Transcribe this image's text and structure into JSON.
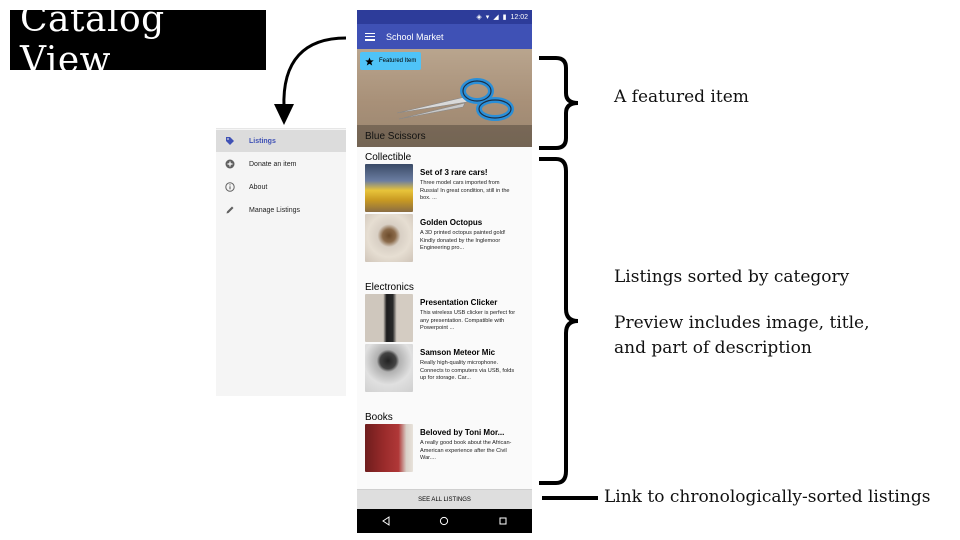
{
  "page_title": "Catalog View",
  "drawer": {
    "items": [
      {
        "label": "Listings",
        "icon": "tag-icon"
      },
      {
        "label": "Donate an item",
        "icon": "add-circle-icon"
      },
      {
        "label": "About",
        "icon": "info-icon"
      },
      {
        "label": "Manage Listings",
        "icon": "pencil-icon"
      }
    ]
  },
  "phone": {
    "status_time": "12:02",
    "app_title": "School Market",
    "featured": {
      "chip_label": "Featured Item",
      "caption": "Blue Scissors"
    },
    "categories": [
      {
        "name": "Collectible",
        "items": [
          {
            "title": "Set of 3 rare cars!",
            "desc": "Three model cars imported from Russia! In great condition, still in the box. ..."
          },
          {
            "title": "Golden Octopus",
            "desc": "A 3D printed octopus painted gold! Kindly donated by the Inglemoor Engineering pro..."
          }
        ]
      },
      {
        "name": "Electronics",
        "items": [
          {
            "title": "Presentation Clicker",
            "desc": "This wireless USB clicker is perfect for any presentation. Compatible with Powerpoint ..."
          },
          {
            "title": "Samson Meteor Mic",
            "desc": "Really high-quality microphone. Connects to computers via USB, folds up for storage. Car..."
          }
        ]
      },
      {
        "name": "Books",
        "items": [
          {
            "title": "Beloved by Toni Mor...",
            "desc": "A really good book about the African-American experience after the Civil War...."
          }
        ]
      }
    ],
    "see_all_label": "SEE ALL LISTINGS"
  },
  "annotations": {
    "featured": "A featured item",
    "sorted": "Listings sorted by category",
    "preview_line1": "Preview includes image, title,",
    "preview_line2": "and part of description",
    "link": "Link to chronologically-sorted listings"
  },
  "colors": {
    "primary": "#3f51b5",
    "status_bar": "#2d3c9a",
    "chip": "#4fc3f7"
  }
}
